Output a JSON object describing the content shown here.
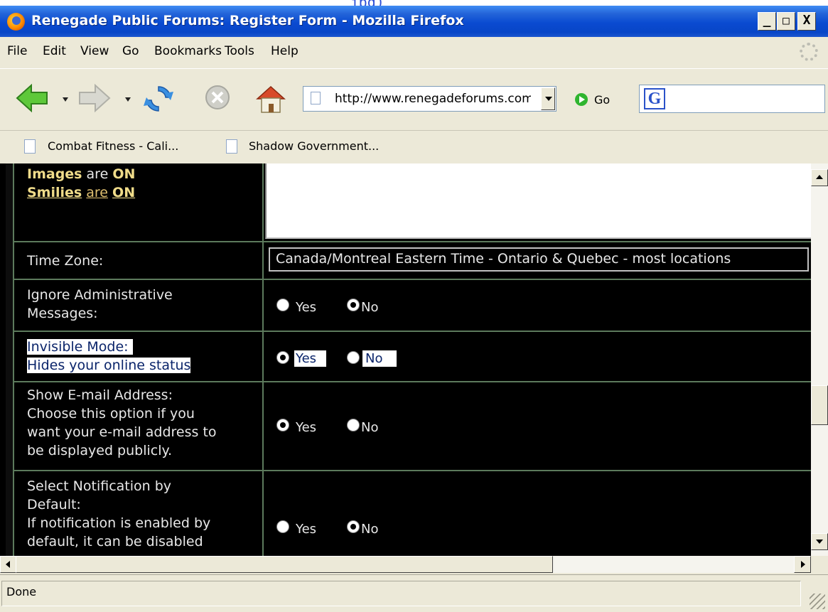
{
  "window": {
    "title": "Renegade Public Forums: Register Form - Mozilla Firefox",
    "buttons": {
      "minimize": "_",
      "maximize": "□",
      "close": "X"
    }
  },
  "menu": [
    "File",
    "Edit",
    "View",
    "Go",
    "Bookmarks",
    "Tools",
    "Help"
  ],
  "nav": {
    "url": "http://www.renegadeforums.com/",
    "go_label": "Go",
    "search_logo": "G"
  },
  "bookmarks": [
    "Combat Fitness - Cali...",
    "Shadow Government..."
  ],
  "form": {
    "images_word": "Images",
    "smilies_word": "Smilies",
    "are": "are",
    "on": "ON",
    "time_zone_label": "Time Zone:",
    "time_zone_value": "Canada/Montreal Eastern Time - Ontario & Quebec - most locations",
    "rows": [
      {
        "label_lines": [
          "Ignore Administrative",
          "Messages:"
        ],
        "selected": "No",
        "highlight": false
      },
      {
        "label_lines": [
          "Invisible Mode:",
          "Hides your online status"
        ],
        "selected": "Yes",
        "highlight": true
      },
      {
        "label_lines": [
          "Show E-mail Address:",
          "Choose this option if you",
          "want your e-mail address to",
          "be displayed publicly."
        ],
        "selected": "Yes",
        "highlight": false
      },
      {
        "label_lines": [
          "Select Notification by",
          "Default:",
          "If notification is enabled by",
          "default, it can be disabled"
        ],
        "selected": "No",
        "highlight": false
      }
    ],
    "yes_label": "Yes",
    "no_label": "No"
  },
  "status": {
    "text": "Done"
  }
}
